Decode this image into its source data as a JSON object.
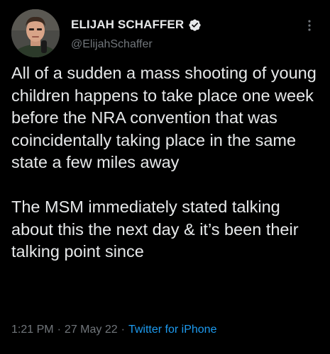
{
  "user": {
    "display_name": "ELIJAH SCHAFFER",
    "handle": "@ElijahSchaffer",
    "verified_icon": "verified-badge-icon",
    "avatar_icon": "profile-photo"
  },
  "tweet": {
    "text": "All of a sudden a mass shooting of young children happens to take place one week before the NRA convention that was coincidentally taking place in the same state a few miles away\n\nThe MSM immediately stated talking about this the next day & it’s been their talking point since",
    "time": "1:21 PM",
    "date": "27 May 22",
    "separator": "·",
    "source": "Twitter for iPhone"
  },
  "menu": {
    "more_icon": "more-vertical-icon"
  },
  "colors": {
    "background": "#000000",
    "text": "#e7e9ea",
    "muted": "#71767b",
    "accent": "#1d9bf0"
  }
}
